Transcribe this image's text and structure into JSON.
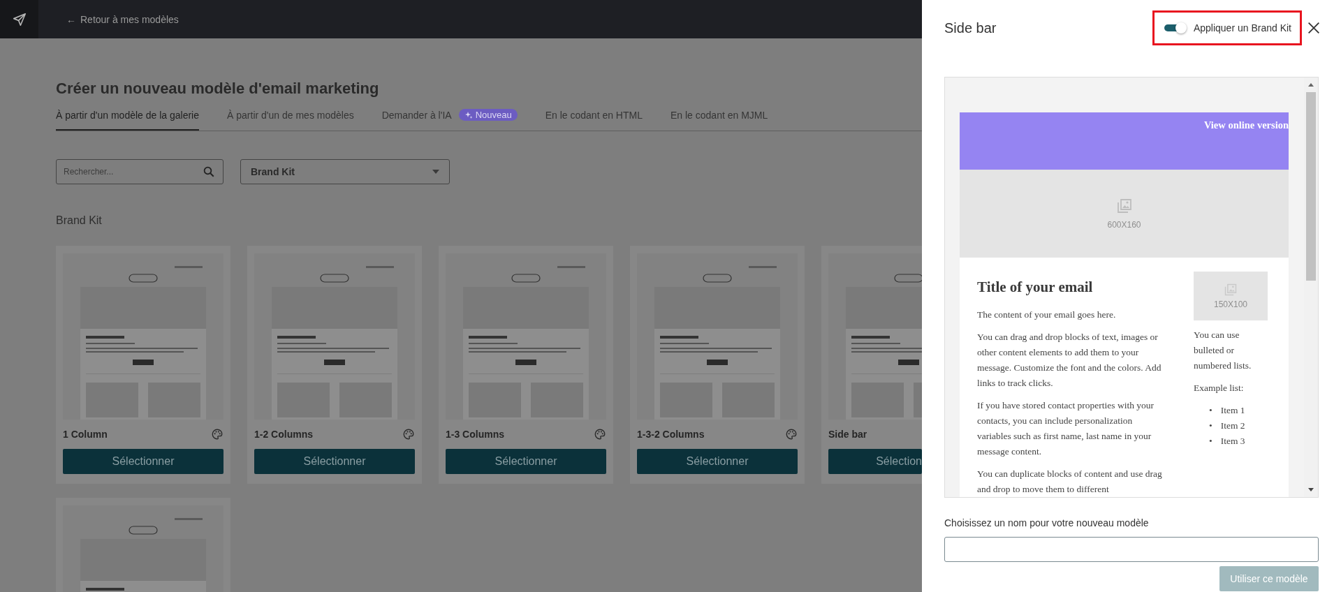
{
  "topbar": {
    "back_arrow": "←",
    "back_label": "Retour à mes modèles"
  },
  "page": {
    "title": "Créer un nouveau modèle d'email marketing",
    "tabs": [
      {
        "label": "À partir d'un modèle de la galerie",
        "selected": true
      },
      {
        "label": "À partir d'un de mes modèles",
        "selected": false
      },
      {
        "label": "Demander à l'IA",
        "selected": false,
        "badge": "Nouveau"
      },
      {
        "label": "En le codant en HTML",
        "selected": false
      },
      {
        "label": "En le codant en MJML",
        "selected": false
      }
    ],
    "search": {
      "placeholder": "Rechercher..."
    },
    "filter": {
      "value": "Brand Kit"
    },
    "section_title": "Brand Kit",
    "templates": [
      {
        "name": "1 Column",
        "button": "Sélectionner",
        "cut": false
      },
      {
        "name": "1-2 Columns",
        "button": "Sélectionner",
        "cut": false
      },
      {
        "name": "1-3 Columns",
        "button": "Sélectionner",
        "cut": false
      },
      {
        "name": "1-3-2 Columns",
        "button": "Sélectionner",
        "cut": false
      },
      {
        "name": "Side bar",
        "button": "Sélection",
        "cut": true
      },
      {
        "cut": false
      }
    ]
  },
  "side_panel": {
    "title": "Side bar",
    "brand_kit": {
      "label": "Appliquer un Brand Kit",
      "on": true
    },
    "preview": {
      "view_online": "View online version",
      "hero_label": "600X160",
      "title": "Title of your email",
      "paragraphs": [
        "The content of your email goes here.",
        "You can drag and drop blocks of text, images or other content elements to add them to your message. Customize the font and the colors. Add links to track clicks.",
        "If you have stored contact properties with your contacts, you can include personalization variables such as first name, last name in your message content.",
        "You can duplicate blocks of content and use drag and drop to move them to different"
      ],
      "side_image_label": "150X100",
      "side_paragraphs": [
        "You can use bulleted or numbered lists.",
        "Example list:"
      ],
      "list_marker": "•",
      "list_items": [
        "Item 1",
        "Item 2",
        "Item 3"
      ]
    },
    "name_field": {
      "label": "Choisissez un nom pour votre nouveau modèle"
    },
    "submit": "Utiliser ce modèle"
  }
}
